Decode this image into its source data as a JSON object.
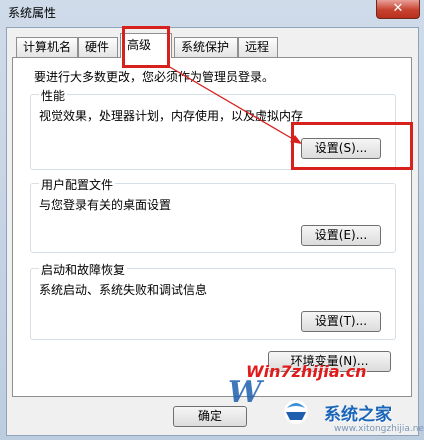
{
  "window": {
    "title": "系统属性",
    "close_label": "✕"
  },
  "tabs": [
    {
      "label": "计算机名"
    },
    {
      "label": "硬件"
    },
    {
      "label": "高级"
    },
    {
      "label": "系统保护"
    },
    {
      "label": "远程"
    }
  ],
  "intro": "要进行大多数更改，您必须作为管理员登录。",
  "groups": {
    "performance": {
      "title": "性能",
      "desc": "视觉效果，处理器计划，内存使用，以及虚拟内存",
      "button": "设置(S)..."
    },
    "user_profiles": {
      "title": "用户配置文件",
      "desc": "与您登录有关的桌面设置",
      "button": "设置(E)..."
    },
    "startup_recovery": {
      "title": "启动和故障恢复",
      "desc": "系统启动、系统失败和调试信息",
      "button": "设置(T)..."
    }
  },
  "env_button": "环境变量(N)...",
  "footer": {
    "ok": "确定"
  },
  "watermark": {
    "url": "Win7zhijia.cn",
    "brand": "系统之家",
    "site": "www.xitongzhijia.net"
  },
  "colors": {
    "highlight": "#d8201c",
    "title_bar": "#c5d5e8",
    "close_button": "#c7412f"
  }
}
